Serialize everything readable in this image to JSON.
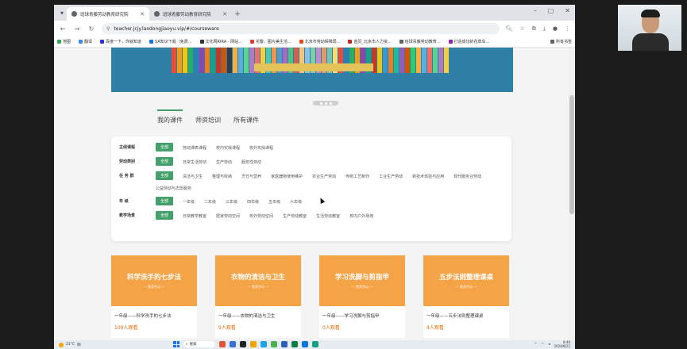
{
  "browser": {
    "tabs": [
      {
        "title": "班球青藤劳动教育研究院",
        "active": true
      },
      {
        "title": "班球青藤劳动教育研究院",
        "active": false
      }
    ],
    "url": "teacher.jcjy.laodongjiaoyu.vip/#/courseware",
    "bookmarks": [
      {
        "label": "地图",
        "color": "#34a853"
      },
      {
        "label": "翻译",
        "color": "#4285f4"
      },
      {
        "label": "百度一下，你就知道",
        "color": "#2932e1"
      },
      {
        "label": "SA知识下载（免费...",
        "color": "#1a73e8"
      },
      {
        "label": "文化网RIRA - 网站...",
        "color": "#333333"
      },
      {
        "label": "花瓣、图片美生活...",
        "color": "#e53935"
      },
      {
        "label": "北京市劳动保障局...",
        "color": "#e64a19"
      },
      {
        "label": "首页_北京市人力资...",
        "color": "#c62828"
      },
      {
        "label": "班球青藤劳动教育...",
        "color": "#5f6368"
      },
      {
        "label": "打造成功的花草车...",
        "color": "#8e24aa"
      }
    ],
    "all_bookmarks": "所有书签"
  },
  "page": {
    "tabs": [
      "我的课件",
      "师资培训",
      "所有课件"
    ],
    "filters": [
      {
        "label": "主线课程",
        "options": [
          "全部",
          "劳动课表课程",
          "校内实操课程",
          "校外实操课程"
        ]
      },
      {
        "label": "劳动类别",
        "options": [
          "全部",
          "日常生活劳动",
          "生产劳动",
          "服务性劳动"
        ]
      },
      {
        "label": "任 务 群",
        "options": [
          "全部",
          "清洁与卫生",
          "整理与收纳",
          "烹饪与营养",
          "家庭器物使用维护",
          "农业生产劳动",
          "传统工艺制作",
          "工业生产劳动",
          "新技术体验与应用",
          "现代服务业劳动",
          "公益劳动与志愿服务"
        ]
      },
      {
        "label": "年 级",
        "options": [
          "全部",
          "一年级",
          "二年级",
          "三年级",
          "四年级",
          "五年级",
          "六年级"
        ]
      },
      {
        "label": "教学场景",
        "options": [
          "全部",
          "日常教学教室",
          "居家劳动空间",
          "校外劳动空间",
          "生产劳动教室",
          "生活劳动教室",
          "校内户外场地"
        ]
      }
    ],
    "courses": [
      {
        "title": "科学洗手的七步法",
        "subtitle": "— 素养劳动 —",
        "name": "一年级——科学洗手的七步法",
        "views": "100人观看"
      },
      {
        "title": "衣物的清洁与卫生",
        "subtitle": "— 素养劳动 —",
        "name": "一年级——衣物的清洁与卫生",
        "views": "9人观看"
      },
      {
        "title": "学习洗脚与剪指甲",
        "subtitle": "— 素养劳动 —",
        "name": "一年级——学习洗脚与剪指甲",
        "views": "0人观看"
      },
      {
        "title": "五步法则整理课桌",
        "subtitle": "— 素养劳动 —",
        "name": "一年级——五步法则整理课桌",
        "views": "4人观看"
      }
    ]
  },
  "taskbar": {
    "weather_temp": "21°C",
    "weather_desc": "阴",
    "search": "搜索",
    "time": "8:46",
    "date": "2024/8/22"
  },
  "colors": {
    "accent": "#46a06b",
    "card": "#f5a347",
    "views": "#e66a00"
  }
}
